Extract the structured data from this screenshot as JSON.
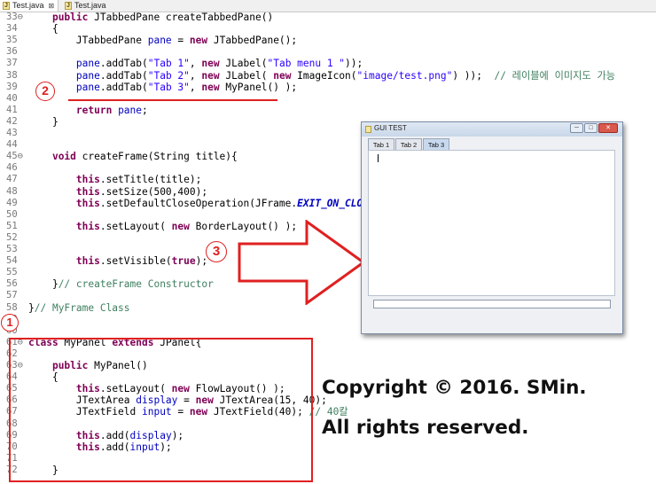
{
  "editor_tabs": [
    {
      "label": "Test.java",
      "close": "⊠"
    },
    {
      "label": "Test.java"
    }
  ],
  "code_lines": [
    {
      "num": "33",
      "fold": "⊖",
      "text": "    public JTabbedPane createTabbedPane()"
    },
    {
      "num": "34",
      "text": "    {"
    },
    {
      "num": "35",
      "text": "        JTabbedPane pane = new JTabbedPane();"
    },
    {
      "num": "36",
      "text": ""
    },
    {
      "num": "37",
      "text": "        pane.addTab(\"Tab 1\", new JLabel(\"Tab menu 1 \"));"
    },
    {
      "num": "38",
      "text": "        pane.addTab(\"Tab 2\", new JLabel( new ImageIcon(\"image/test.png\") ));  // 레이블에 이미지도 가능"
    },
    {
      "num": "39",
      "text": "        pane.addTab(\"Tab 3\", new MyPanel() );"
    },
    {
      "num": "40",
      "text": ""
    },
    {
      "num": "41",
      "text": "        return pane;"
    },
    {
      "num": "42",
      "text": "    }"
    },
    {
      "num": "43",
      "text": ""
    },
    {
      "num": "44",
      "text": ""
    },
    {
      "num": "45",
      "fold": "⊖",
      "text": "    void createFrame(String title){"
    },
    {
      "num": "46",
      "text": ""
    },
    {
      "num": "47",
      "text": "        this.setTitle(title);"
    },
    {
      "num": "48",
      "text": "        this.setSize(500,400);"
    },
    {
      "num": "49",
      "text": "        this.setDefaultCloseOperation(JFrame.EXIT_ON_CLOSE);"
    },
    {
      "num": "50",
      "text": ""
    },
    {
      "num": "51",
      "text": "        this.setLayout( new BorderLayout() );"
    },
    {
      "num": "52",
      "text": ""
    },
    {
      "num": "53",
      "text": ""
    },
    {
      "num": "54",
      "text": "        this.setVisible(true);"
    },
    {
      "num": "55",
      "text": ""
    },
    {
      "num": "56",
      "text": "    }// createFrame Constructor"
    },
    {
      "num": "57",
      "text": ""
    },
    {
      "num": "58",
      "text": "}// MyFrame Class"
    },
    {
      "num": "59",
      "text": ""
    },
    {
      "num": "60",
      "text": ""
    },
    {
      "num": "61",
      "fold": "⊖",
      "text": "class MyPanel extends JPanel{"
    },
    {
      "num": "62",
      "text": ""
    },
    {
      "num": "63",
      "fold": "⊖",
      "text": "    public MyPanel()"
    },
    {
      "num": "64",
      "text": "    {"
    },
    {
      "num": "65",
      "text": "        this.setLayout( new FlowLayout() );"
    },
    {
      "num": "66",
      "text": "        JTextArea display = new JTextArea(15, 40);"
    },
    {
      "num": "67",
      "text": "        JTextField input = new JTextField(40); // 40칼"
    },
    {
      "num": "68",
      "text": ""
    },
    {
      "num": "69",
      "text": "        this.add(display);"
    },
    {
      "num": "70",
      "text": "        this.add(input);"
    },
    {
      "num": "71",
      "text": ""
    },
    {
      "num": "72",
      "text": "    }"
    }
  ],
  "annotations": {
    "one": "1",
    "two": "2",
    "three": "3"
  },
  "gui_window": {
    "title": "GUI TEST",
    "buttons": [
      "─",
      "□",
      "✕"
    ],
    "tabs": [
      "Tab 1",
      "Tab 2",
      "Tab 3"
    ],
    "selected_tab": "Tab 3"
  },
  "copyright": {
    "line1": "Copyright © 2016. SMin.",
    "line2": "All rights reserved."
  },
  "colors": {
    "annotation": "#e02020",
    "keyword": "#7f0055",
    "string": "#2a00ff",
    "comment": "#3f7f5f",
    "field": "#0000c0"
  }
}
